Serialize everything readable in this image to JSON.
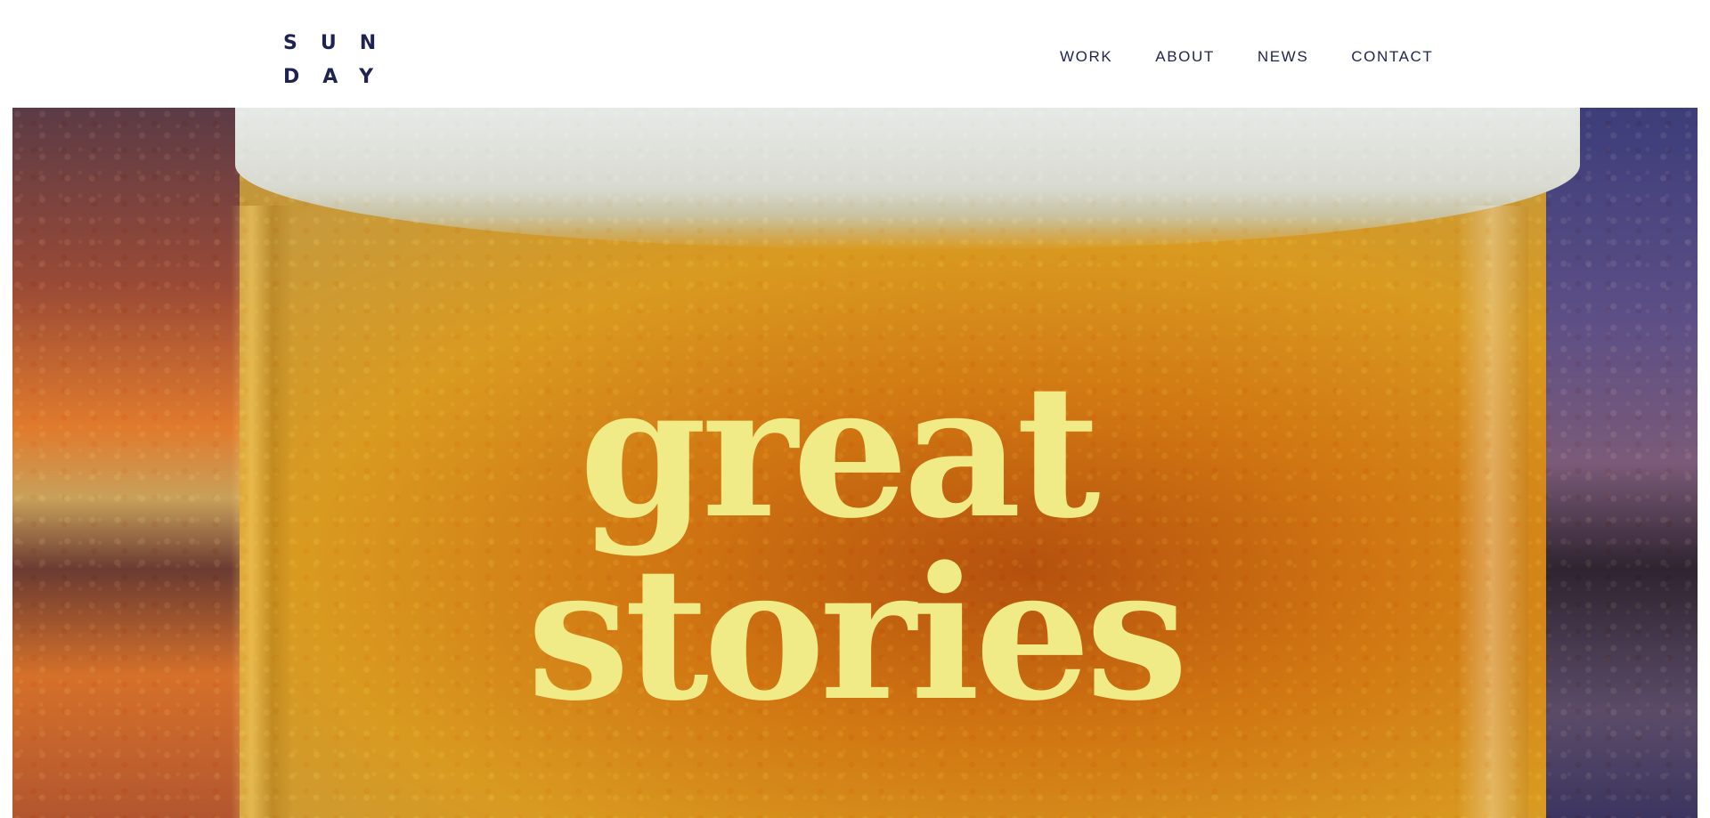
{
  "header": {
    "logo": {
      "line1": "SUN",
      "line2": "DAY"
    },
    "nav": {
      "items": [
        {
          "label": "WORK"
        },
        {
          "label": "ABOUT"
        },
        {
          "label": "NEWS"
        },
        {
          "label": "CONTACT"
        }
      ]
    }
  },
  "hero": {
    "headline": {
      "line1": "great",
      "line2": "stories"
    },
    "image": {
      "subject": "beer glass"
    }
  },
  "colors": {
    "brand_navy": "#1e2352",
    "headline_yellow": "#f0ea87",
    "background": "#ffffff"
  }
}
